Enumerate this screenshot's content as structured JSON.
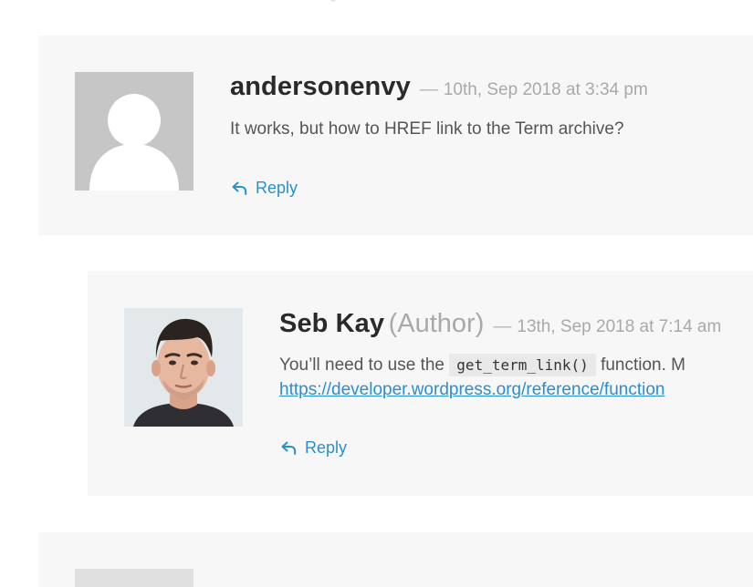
{
  "comments": [
    {
      "author": "andersonenvy",
      "badge": "",
      "separator": "—",
      "date": "10th, Sep 2018 at 3:34 pm",
      "text": "It works, but how to HREF link to the Term archive?",
      "reply_label": "Reply"
    },
    {
      "author": "Seb Kay",
      "badge": "(Author)",
      "separator": "—",
      "date": "13th, Sep 2018 at 7:14 am",
      "text_before": "You’ll need to use the",
      "code": "get_term_link()",
      "text_after": "function. M",
      "link": "https://developer.wordpress.org/reference/function",
      "reply_label": "Reply"
    }
  ],
  "colors": {
    "panel_bg": "#f7f7f7",
    "author": "#2a2a2a",
    "meta": "#a9a9a9",
    "link": "#2b8fc9",
    "body_text": "#555555"
  },
  "icons": {
    "default_avatar": "user-silhouette-icon",
    "reply": "reply-arrow-icon"
  }
}
